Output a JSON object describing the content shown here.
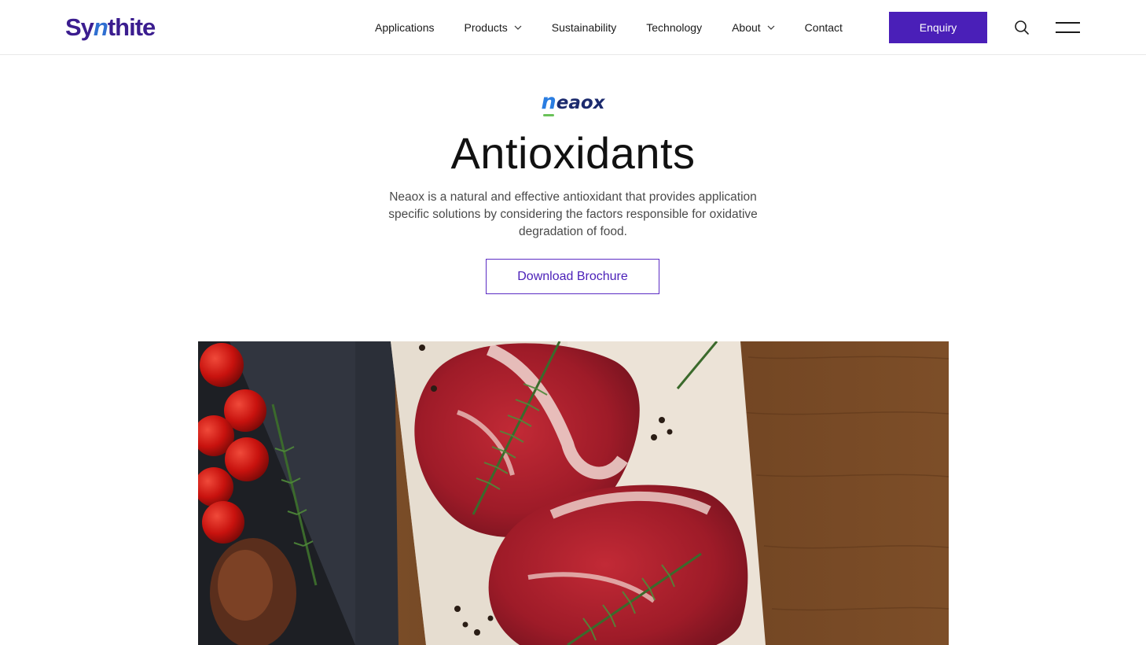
{
  "header": {
    "logo": {
      "text_before": "Sy",
      "text_accent": "n",
      "text_after": "thite"
    },
    "nav": [
      {
        "label": "Applications",
        "has_dropdown": false
      },
      {
        "label": "Products",
        "has_dropdown": true
      },
      {
        "label": "Sustainability",
        "has_dropdown": false
      },
      {
        "label": "Technology",
        "has_dropdown": false
      },
      {
        "label": "About",
        "has_dropdown": true
      },
      {
        "label": "Contact",
        "has_dropdown": false
      }
    ],
    "enquiry_label": "Enquiry",
    "icons": {
      "search": "search-icon",
      "menu": "hamburger-menu-icon",
      "chevron": "chevron-down-icon"
    }
  },
  "hero": {
    "brand": {
      "accent": "n",
      "rest": "eaox"
    },
    "title": "Antioxidants",
    "description": "Neaox is a natural and effective antioxidant that provides application specific solutions by considering the factors responsible for oxidative degradation of food.",
    "cta_label": "Download Brochure"
  },
  "image": {
    "subject": "raw-steaks-with-rosemary"
  },
  "colors": {
    "accent": "#4a1fb8",
    "logo": "#3b1d8f",
    "text": "#1a1a1a",
    "muted": "#4a4a4a"
  }
}
